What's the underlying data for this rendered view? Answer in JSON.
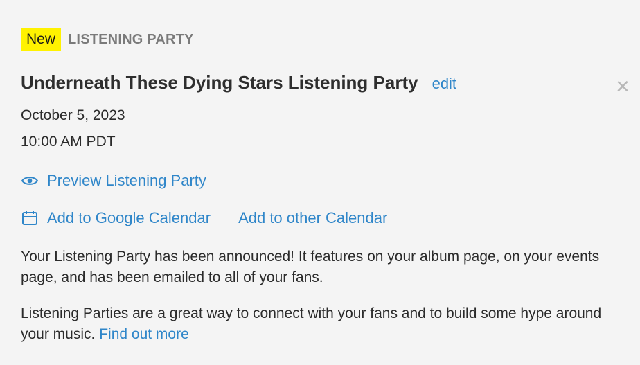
{
  "badge": {
    "new_label": "New",
    "section_label": "LISTENING PARTY",
    "highlight_color": "#fff200"
  },
  "event": {
    "title": "Underneath These Dying Stars Listening Party",
    "edit_label": "edit",
    "date": "October 5, 2023",
    "time": "10:00 AM PDT"
  },
  "close": {
    "icon": "close-icon",
    "glyph": "✕"
  },
  "actions": {
    "preview_label": "Preview Listening Party",
    "preview_icon": "eye-icon",
    "google_calendar_label": "Add to Google Calendar",
    "calendar_icon": "calendar-icon",
    "other_calendar_label": "Add to other Calendar"
  },
  "body": {
    "announcement": "Your Listening Party has been announced! It features on your album page, on your events page, and has been emailed to all of your fans.",
    "promo_text": "Listening Parties are a great way to connect with your fans and to build some hype around your music.",
    "find_out_more_label": "Find out more"
  },
  "colors": {
    "link": "#2f86c9",
    "text": "#2b2b2b",
    "muted": "#7a7a7a",
    "background": "#f4f4f4"
  }
}
